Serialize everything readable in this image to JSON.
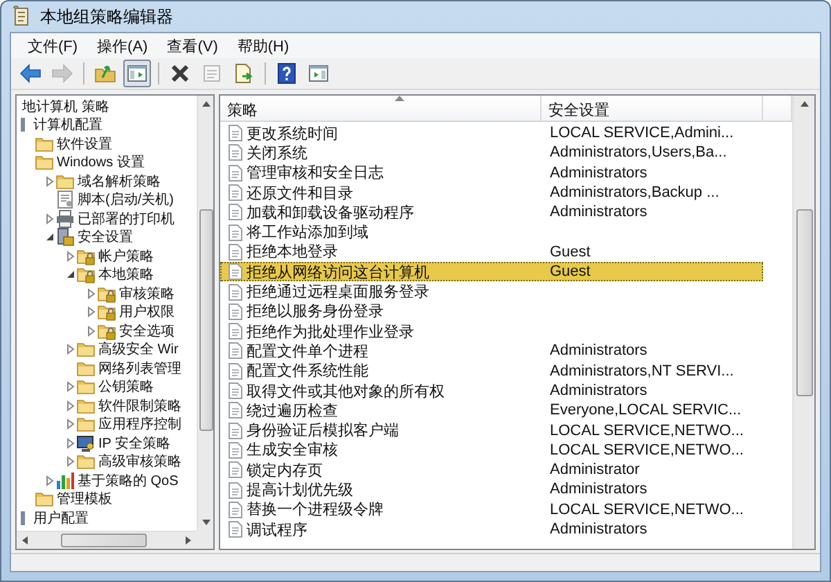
{
  "window": {
    "title": "本地组策略编辑器"
  },
  "menu": [
    {
      "label": "文件(F)"
    },
    {
      "label": "操作(A)"
    },
    {
      "label": "查看(V)"
    },
    {
      "label": "帮助(H)"
    }
  ],
  "toolbar": [
    {
      "kind": "back",
      "disabled": false,
      "pressed": false
    },
    {
      "kind": "forward",
      "disabled": true,
      "pressed": false
    },
    {
      "kind": "separator"
    },
    {
      "kind": "up",
      "disabled": false,
      "pressed": false
    },
    {
      "kind": "tree",
      "disabled": false,
      "pressed": true
    },
    {
      "kind": "separator"
    },
    {
      "kind": "delete",
      "disabled": false,
      "pressed": false
    },
    {
      "kind": "properties",
      "disabled": true,
      "pressed": false
    },
    {
      "kind": "export",
      "disabled": false,
      "pressed": false
    },
    {
      "kind": "separator"
    },
    {
      "kind": "help",
      "disabled": false,
      "pressed": false
    },
    {
      "kind": "pane",
      "disabled": false,
      "pressed": false
    }
  ],
  "tree": [
    {
      "label": "地计算机 策略",
      "children": [
        {
          "label": "计算机配置",
          "kind": "computer",
          "children": [
            {
              "label": "软件设置",
              "kind": "folder"
            },
            {
              "label": "Windows 设置",
              "kind": "folder",
              "children": [
                {
                  "label": "域名解析策略",
                  "kind": "folder",
                  "expanded": false
                },
                {
                  "label": "脚本(启动/关机)",
                  "kind": "script"
                },
                {
                  "label": "已部署的打印机",
                  "kind": "printer",
                  "expanded": false
                },
                {
                  "label": "安全设置",
                  "kind": "security",
                  "expanded": true,
                  "children": [
                    {
                      "label": "帐户策略",
                      "kind": "lockfolder",
                      "expanded": false
                    },
                    {
                      "label": "本地策略",
                      "kind": "lockfolder",
                      "expanded": true,
                      "children": [
                        {
                          "label": "审核策略",
                          "kind": "lockfolder",
                          "expanded": false
                        },
                        {
                          "label": "用户权限",
                          "kind": "lockfolder",
                          "expanded": false
                        },
                        {
                          "label": "安全选项",
                          "kind": "lockfolder",
                          "expanded": false
                        }
                      ]
                    },
                    {
                      "label": "高级安全 Wir",
                      "kind": "folder",
                      "expanded": false
                    },
                    {
                      "label": "网络列表管理",
                      "kind": "folder"
                    },
                    {
                      "label": "公钥策略",
                      "kind": "folder",
                      "expanded": false
                    },
                    {
                      "label": "软件限制策略",
                      "kind": "folder",
                      "expanded": false
                    },
                    {
                      "label": "应用程序控制",
                      "kind": "folder",
                      "expanded": false
                    },
                    {
                      "label": "IP 安全策略",
                      "kind": "ipsec",
                      "expanded": false
                    },
                    {
                      "label": "高级审核策略",
                      "kind": "folder",
                      "expanded": false
                    }
                  ]
                },
                {
                  "label": "基于策略的 QoS",
                  "kind": "qos",
                  "expanded": false
                }
              ]
            },
            {
              "label": "管理模板",
              "kind": "folder"
            }
          ]
        },
        {
          "label": "用户配置",
          "kind": "computer"
        }
      ]
    }
  ],
  "table": {
    "columns": [
      "策略",
      "安全设置"
    ],
    "rows": [
      {
        "policy": "更改系统时间",
        "setting": "LOCAL SERVICE,Admini...",
        "selected": false
      },
      {
        "policy": "关闭系统",
        "setting": "Administrators,Users,Ba...",
        "selected": false
      },
      {
        "policy": "管理审核和安全日志",
        "setting": "Administrators",
        "selected": false
      },
      {
        "policy": "还原文件和目录",
        "setting": "Administrators,Backup ...",
        "selected": false
      },
      {
        "policy": "加载和卸载设备驱动程序",
        "setting": "Administrators",
        "selected": false
      },
      {
        "policy": "将工作站添加到域",
        "selected": false
      },
      {
        "policy": "拒绝本地登录",
        "setting": "Guest",
        "selected": false
      },
      {
        "policy": "拒绝从网络访问这台计算机",
        "setting": "Guest",
        "selected": true
      },
      {
        "policy": "拒绝通过远程桌面服务登录",
        "selected": false
      },
      {
        "policy": "拒绝以服务身份登录",
        "selected": false
      },
      {
        "policy": "拒绝作为批处理作业登录",
        "selected": false
      },
      {
        "policy": "配置文件单个进程",
        "setting": "Administrators",
        "selected": false
      },
      {
        "policy": "配置文件系统性能",
        "setting": "Administrators,NT SERVI...",
        "selected": false
      },
      {
        "policy": "取得文件或其他对象的所有权",
        "setting": "Administrators",
        "selected": false
      },
      {
        "policy": "绕过遍历检查",
        "setting": "Everyone,LOCAL SERVIC...",
        "selected": false
      },
      {
        "policy": "身份验证后模拟客户端",
        "setting": "LOCAL SERVICE,NETWO...",
        "selected": false
      },
      {
        "policy": "生成安全审核",
        "setting": "LOCAL SERVICE,NETWO...",
        "selected": false
      },
      {
        "policy": "锁定内存页",
        "setting": "Administrator",
        "selected": false
      },
      {
        "policy": "提高计划优先级",
        "setting": "Administrators",
        "selected": false
      },
      {
        "policy": "替换一个进程级令牌",
        "setting": "LOCAL SERVICE,NETWO...",
        "selected": false
      },
      {
        "policy": "调试程序",
        "setting": "Administrators",
        "selected": false
      }
    ]
  }
}
